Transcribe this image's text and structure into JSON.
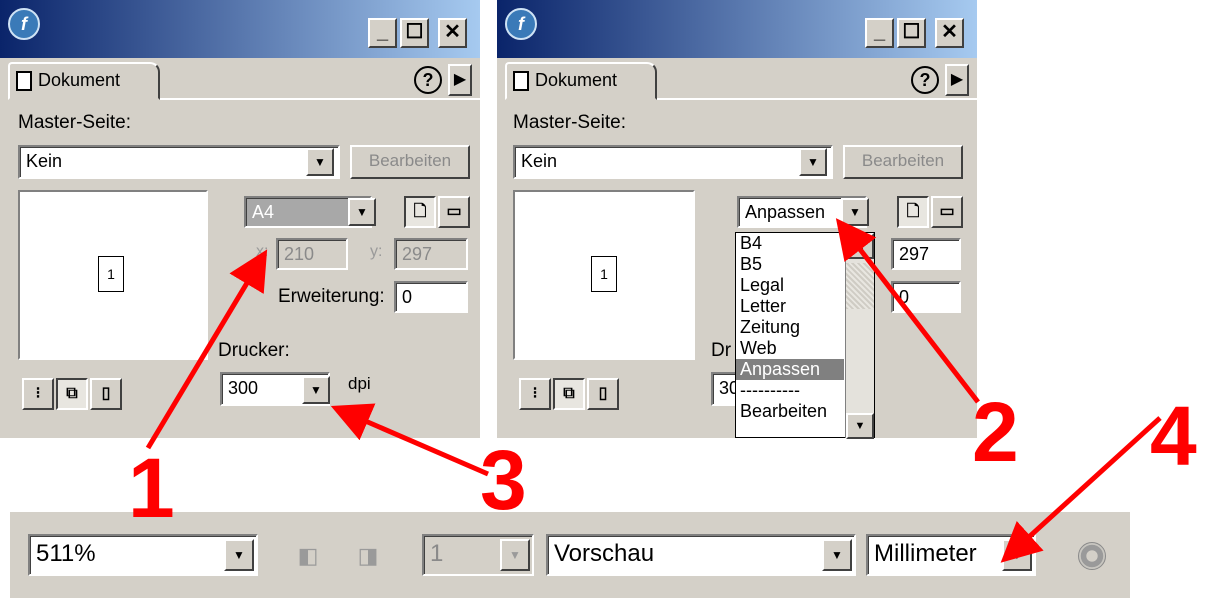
{
  "panel_left": {
    "tab_label": "Dokument",
    "master_label": "Master-Seite:",
    "master_value": "Kein",
    "edit_button": "Bearbeiten",
    "page_number": "1",
    "paper_size": "A4",
    "x_label": "x:",
    "x_value": "210",
    "y_label": "y:",
    "y_value": "297",
    "bleed_label": "Erweiterung:",
    "bleed_value": "0",
    "printer_label": "Drucker:",
    "dpi_value": "300",
    "dpi_unit": "dpi"
  },
  "panel_right": {
    "tab_label": "Dokument",
    "master_label": "Master-Seite:",
    "master_value": "Kein",
    "edit_button": "Bearbeiten",
    "page_number": "1",
    "paper_size": "Anpassen",
    "y_value": "297",
    "bleed_value": "0",
    "printer_label_partial": "Dr",
    "dpi_partial": "30",
    "dropdown_options": [
      "B4",
      "B5",
      "Legal",
      "Letter",
      "Zeitung",
      "Web",
      "Anpassen",
      "----------",
      "Bearbeiten"
    ],
    "selected_option": "Anpassen"
  },
  "toolbar": {
    "zoom": "511%",
    "page": "1",
    "view_mode": "Vorschau",
    "units": "Millimeter"
  },
  "annotations": {
    "n1": "1",
    "n2": "2",
    "n3": "3",
    "n4": "4",
    "color": "#ff0000"
  },
  "icons": [
    "app-icon",
    "minimize-icon",
    "maximize-icon",
    "close-icon",
    "help-icon",
    "panel-menu-icon",
    "document-icon",
    "portrait-icon",
    "landscape-icon",
    "dropdown-arrow-icon",
    "previous-page-icon",
    "next-page-icon",
    "render-status-icon"
  ]
}
